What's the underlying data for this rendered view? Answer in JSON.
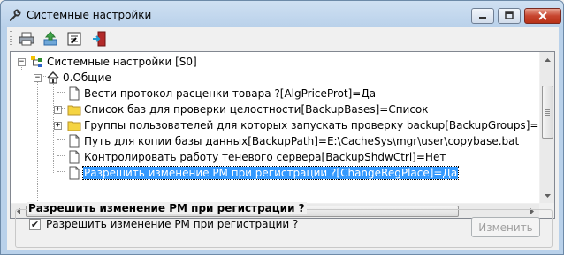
{
  "window": {
    "title": "Системные настройки",
    "title_icon": "wrench-icon"
  },
  "titlebar_buttons": [
    "minimize-icon",
    "maximize-icon",
    "close-icon"
  ],
  "toolbar": {
    "buttons": [
      "print-icon",
      "refresh-icon",
      "export-icon",
      "exit-icon"
    ]
  },
  "tree": {
    "root": {
      "label": "Системные настройки [S0]",
      "icon": "tree-root-icon",
      "expanded": true
    },
    "group": {
      "label": "0.Общие",
      "icon": "home-icon",
      "expanded": true
    },
    "items": [
      {
        "label": "Вести протокол расценки товара ?[AlgPriceProt]=Да",
        "icon": "document-icon",
        "expandable": false,
        "selected": false
      },
      {
        "label": "Список баз для проверки целостности[BackupBases]=Список",
        "icon": "folder-icon",
        "expandable": true,
        "selected": false
      },
      {
        "label": "Группы пользователей для которых запускать проверку backup[BackupGroups]=Список",
        "icon": "folder-icon",
        "expandable": true,
        "selected": false
      },
      {
        "label": "Путь для копии базы данных[BackupPath]=E:\\CacheSys\\mgr\\user\\copybase.bat",
        "icon": "document-icon",
        "expandable": false,
        "selected": false
      },
      {
        "label": "Контролировать работу теневого сервера[BackupShdwCtrl]=Нет",
        "icon": "document-icon",
        "expandable": false,
        "selected": false
      },
      {
        "label": "Разрешить изменение РМ при регистрации ?[ChangeRegPlace]=Да",
        "icon": "document-icon",
        "expandable": false,
        "selected": true
      }
    ]
  },
  "detail": {
    "caption": "Разрешить изменение РМ при регистрации ?",
    "checkbox_label": "Разрешить изменение РМ при регистрации ?",
    "checked": true,
    "edit_button": "Изменить",
    "edit_enabled": false
  },
  "colors": {
    "selection": "#3399ff",
    "titlebar": "#b9d1ea",
    "close_button": "#c7452f",
    "folder": "#f5d442"
  }
}
